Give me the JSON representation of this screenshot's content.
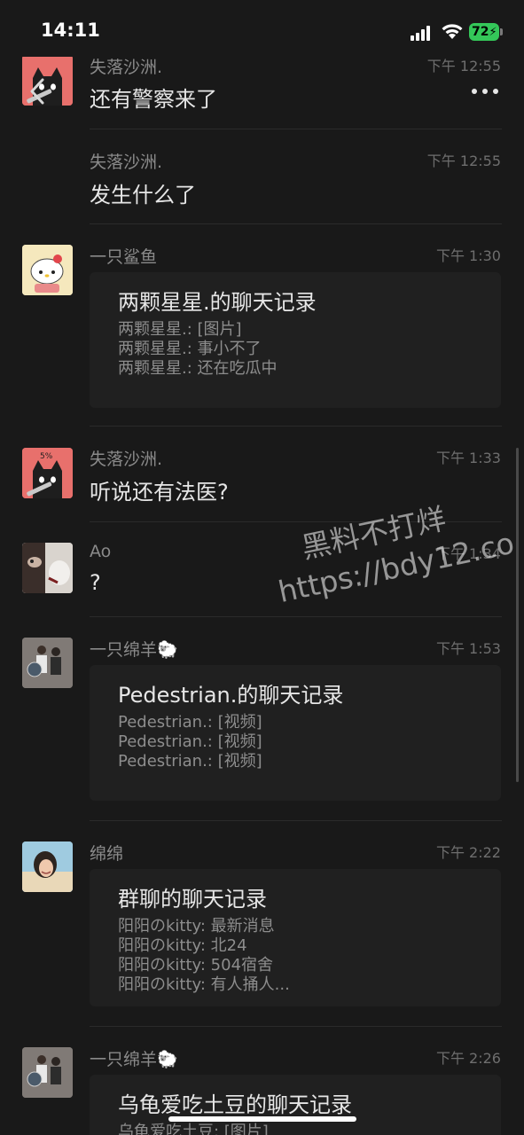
{
  "status_bar": {
    "time": "14:11",
    "battery": "72"
  },
  "messages": [
    {
      "sender": "失落沙洲.",
      "time": "下午 12:55",
      "text": "还有警察来了",
      "avatar": "cat-knife"
    },
    {
      "sender": "失落沙洲.",
      "time": "下午 12:55",
      "text": "发生什么了"
    },
    {
      "sender": "一只鲨鱼",
      "time": "下午 1:30",
      "avatar": "hello-kitty",
      "card": {
        "title": "两颗星星.的聊天记录",
        "lines": [
          "两颗星星.: [图片]",
          "两颗星星.: 事小不了",
          "两颗星星.: 还在吃瓜中"
        ]
      }
    },
    {
      "sender": "失落沙洲.",
      "time": "下午 1:33",
      "text": "听说还有法医?",
      "avatar": "cat-knife"
    },
    {
      "sender": "Ao",
      "time": "下午 1:34",
      "text": "?",
      "avatar": "selfie-dog"
    },
    {
      "sender": "一只绵羊🐑",
      "time": "下午 1:53",
      "avatar": "couple-photo",
      "card": {
        "title": "Pedestrian.的聊天记录",
        "lines": [
          "Pedestrian.: [视频]",
          "Pedestrian.: [视频]",
          "Pedestrian.: [视频]"
        ]
      }
    },
    {
      "sender": "绵绵",
      "time": "下午 2:22",
      "avatar": "girl-beach",
      "card": {
        "title": "群聊的聊天记录",
        "lines": [
          "阳阳のkitty: 最新消息",
          "阳阳のkitty: 北24",
          "阳阳のkitty: 504宿舍",
          "阳阳のkitty: 有人捅人..."
        ]
      }
    },
    {
      "sender": "一只绵羊🐑",
      "time": "下午 2:26",
      "avatar": "couple-photo",
      "card": {
        "title": "乌龟爱吃土豆的聊天记录",
        "lines": [
          "乌龟爱吃土豆: [图片]"
        ]
      }
    }
  ],
  "watermark": {
    "line1": "黑料不打烊",
    "line2": "https://bdy12.co"
  },
  "avatar_badges": {
    "cat_percent": "5%"
  },
  "colors": {
    "background": "#191919",
    "card": "#202020",
    "battery": "#34c759"
  }
}
